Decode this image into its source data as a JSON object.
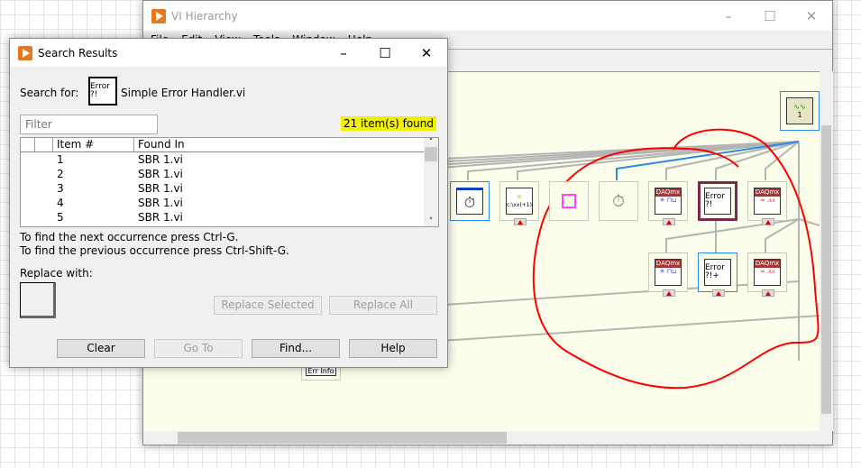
{
  "hierarchy_window": {
    "title": "VI Hierarchy",
    "menu": [
      "File",
      "Edit",
      "View",
      "Tools",
      "Window",
      "Help"
    ],
    "nodes": {
      "top": {
        "icon": "waveform-chart-icon",
        "badge": "1"
      },
      "row1": [
        {
          "icon": "stopwatch-question-icon"
        },
        {
          "icon": "new-file-path-icon",
          "text": "c:\\xx(+1)"
        },
        {
          "icon": "pink-square-icon"
        },
        {
          "icon": "stopwatch-icon"
        },
        {
          "icon": "daqmx-create-task-icon",
          "header": "DAQmx"
        },
        {
          "icon": "simple-error-handler-icon",
          "text": "Error ?!"
        },
        {
          "icon": "daqmx-read-icon",
          "header": "DAQmx"
        }
      ],
      "row2": [
        {
          "icon": "daqmx-create-task-icon",
          "header": "DAQmx"
        },
        {
          "icon": "general-error-handler-icon",
          "text": "Error ?!+"
        },
        {
          "icon": "daqmx-read-icon",
          "header": "DAQmx"
        }
      ],
      "err_info": "Err Info"
    },
    "annotation_color": "#ff0000",
    "highlight_color": "#7a2a4e",
    "selection_color": "#2a8ae8"
  },
  "search_dialog": {
    "title": "Search Results",
    "search_for_label": "Search for:",
    "search_target": "Simple Error Handler.vi",
    "search_icon_text": "Error ?!",
    "filter_placeholder": "Filter",
    "found_count": "21 item(s) found",
    "columns": [
      "Item #",
      "Found In"
    ],
    "rows": [
      {
        "item": "1",
        "found_in": "SBR 1.vi"
      },
      {
        "item": "2",
        "found_in": "SBR 1.vi"
      },
      {
        "item": "3",
        "found_in": "SBR 1.vi"
      },
      {
        "item": "4",
        "found_in": "SBR 1.vi"
      },
      {
        "item": "5",
        "found_in": "SBR 1.vi"
      }
    ],
    "hint_next": "To find the next occurrence press Ctrl-G.",
    "hint_prev": "To find the previous occurrence press Ctrl-Shift-G.",
    "replace_label": "Replace with:",
    "buttons": {
      "replace_selected": "Replace Selected",
      "replace_all": "Replace All",
      "clear": "Clear",
      "goto": "Go To",
      "find": "Find...",
      "help": "Help"
    }
  }
}
